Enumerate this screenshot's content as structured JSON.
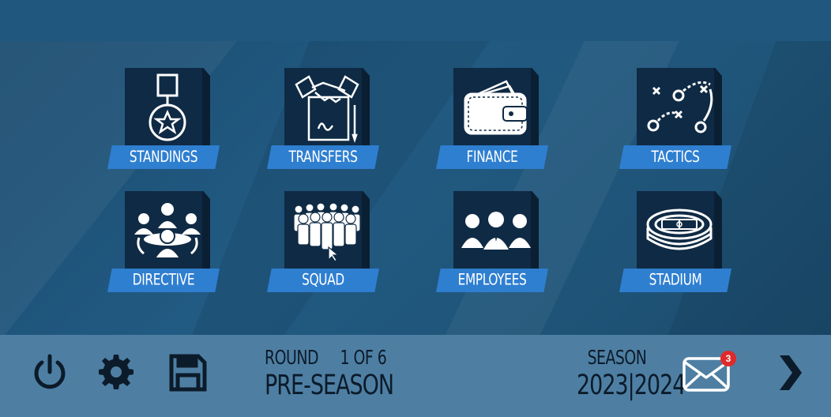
{
  "menu": {
    "tiles": [
      {
        "label": "STANDINGS",
        "icon": "medal-icon"
      },
      {
        "label": "TRANSFERS",
        "icon": "handshake-contract-icon"
      },
      {
        "label": "FINANCE",
        "icon": "wallet-icon"
      },
      {
        "label": "TACTICS",
        "icon": "tactics-board-icon"
      },
      {
        "label": "DIRECTIVE",
        "icon": "meeting-table-icon"
      },
      {
        "label": "SQUAD",
        "icon": "crowd-icon"
      },
      {
        "label": "EMPLOYEES",
        "icon": "staff-icon"
      },
      {
        "label": "STADIUM",
        "icon": "stadium-icon"
      }
    ]
  },
  "footer": {
    "round_label": "ROUND",
    "round_value": "1 OF 6",
    "phase": "PRE-SEASON",
    "season_label": "SEASON",
    "season_years": "2023|2024",
    "mail_count": "3",
    "icons": [
      "power-icon",
      "gear-icon",
      "save-icon",
      "mail-icon",
      "chevron-right-icon"
    ]
  },
  "colors": {
    "background": "#1f5478",
    "tile": "#0f2a44",
    "label_bar": "#2f7fd1",
    "bottom_bar": "#4e7fa3",
    "badge": "#e02a2a"
  }
}
